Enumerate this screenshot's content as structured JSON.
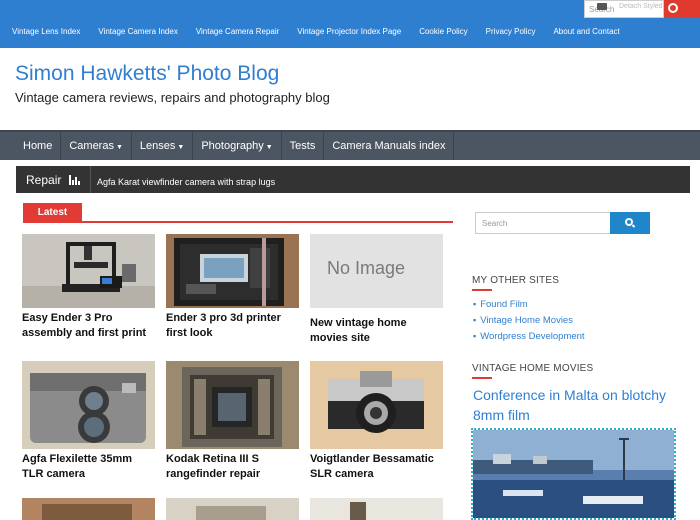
{
  "topnav": [
    "Vintage Lens Index",
    "Vintage Camera Index",
    "Vintage Camera Repair",
    "Vintage Projector Index Page",
    "Cookie Policy",
    "Privacy Policy",
    "About and Contact"
  ],
  "top_search": {
    "placeholder": "Search",
    "overlay": "Detach Styled Images"
  },
  "site": {
    "title": "Simon Hawketts' Photo Blog",
    "description": "Vintage camera reviews, repairs and photography blog"
  },
  "mainnav": [
    {
      "label": "Home",
      "dropdown": false
    },
    {
      "label": "Cameras",
      "dropdown": true
    },
    {
      "label": "Lenses",
      "dropdown": true
    },
    {
      "label": "Photography",
      "dropdown": true
    },
    {
      "label": "Tests",
      "dropdown": false
    },
    {
      "label": "Camera Manuals index",
      "dropdown": false
    }
  ],
  "ticker": {
    "label": "Repair",
    "text": "Agfa Karat viewfinder camera with strap lugs"
  },
  "latest_label": "Latest",
  "posts": [
    {
      "title": "Easy Ender 3 Pro assembly and first print"
    },
    {
      "title": "Ender 3 pro 3d printer first look"
    },
    {
      "title": "New vintage home movies site",
      "noimage": "No Image"
    },
    {
      "title": "Agfa Flexilette 35mm TLR camera"
    },
    {
      "title": "Kodak Retina III S rangefinder repair"
    },
    {
      "title": "Voigtlander Bessamatic SLR camera"
    }
  ],
  "sidebar": {
    "search_placeholder": "Search",
    "other_sites_heading": "MY OTHER SITES",
    "other_sites": [
      "Found Film",
      "Vintage Home Movies",
      "Wordpress Development"
    ],
    "home_movies_heading": "VINTAGE HOME MOVIES",
    "home_movies_post": "Conference in Malta on blotchy 8mm film"
  },
  "colors": {
    "topbar": "#2f7fd1",
    "accent": "#e23b36",
    "nav": "#4b5662",
    "link": "#2f7fd1"
  }
}
